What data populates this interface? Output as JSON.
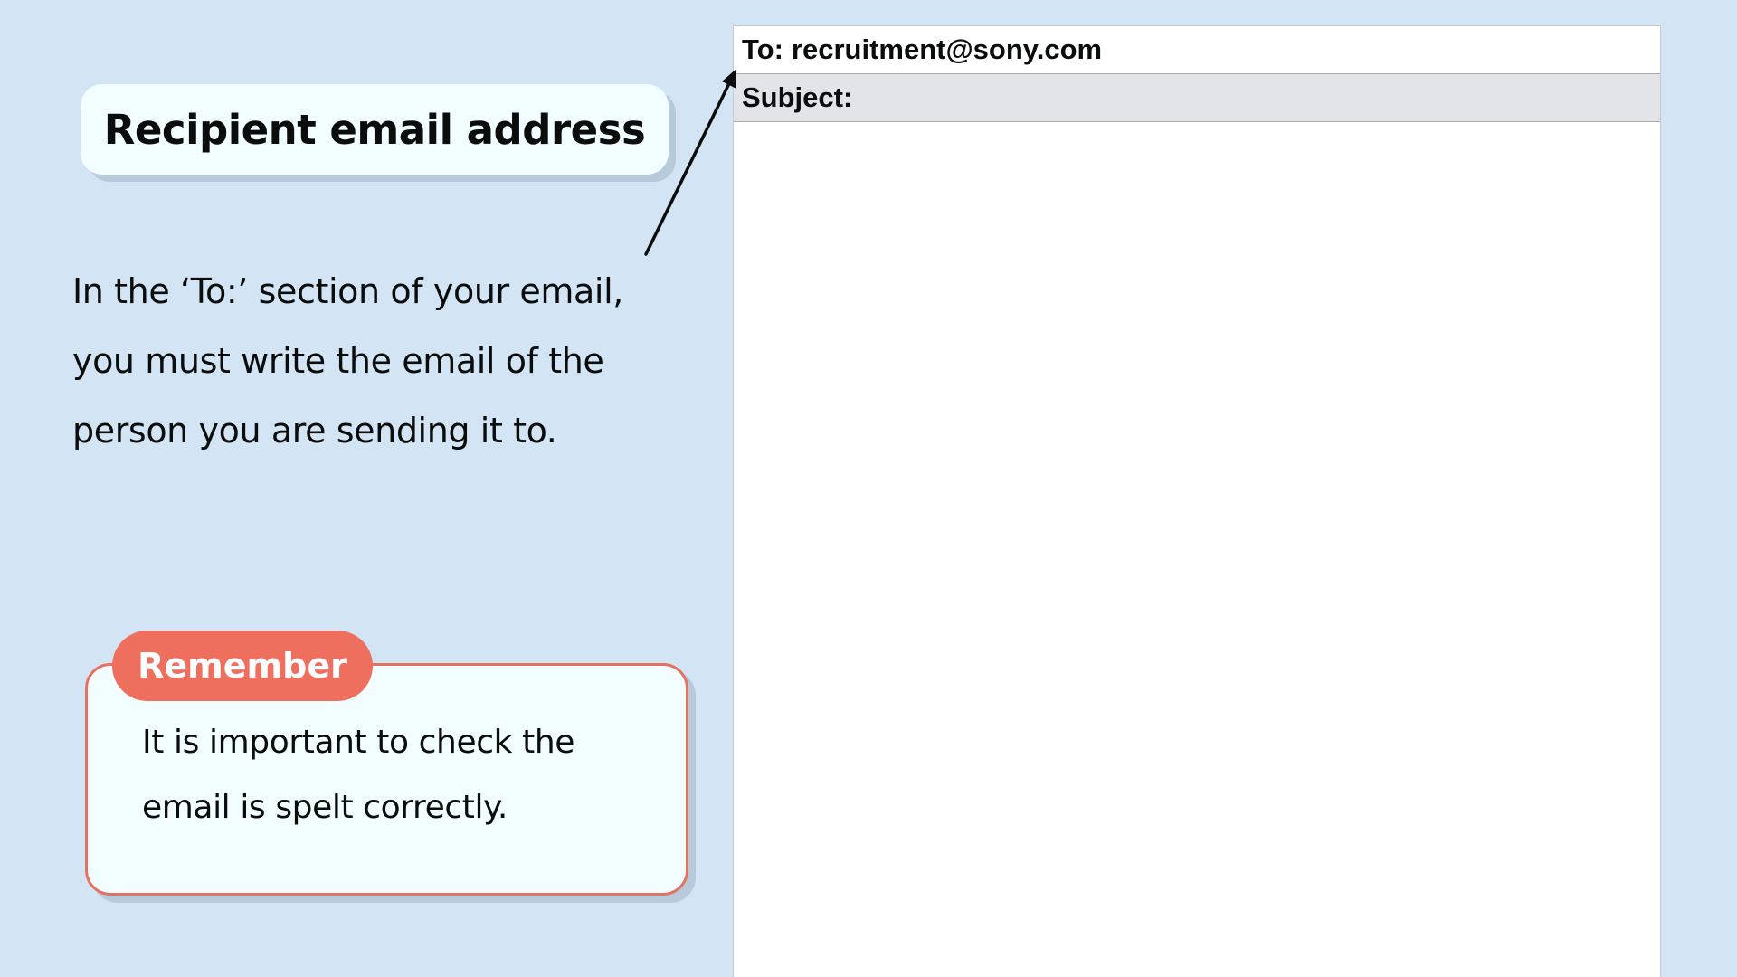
{
  "title": "Recipient email address",
  "explanation": {
    "lines": [
      "In the ‘To:’ section of your email,",
      "you must write the email of the",
      "person you are sending it to."
    ]
  },
  "remember": {
    "label": "Remember",
    "lines": [
      "It is important to check the",
      "email is spelt correctly."
    ]
  },
  "email": {
    "to_label": "To:",
    "to_value": "recruitment@sony.com",
    "subject_label": "Subject:",
    "subject_value": "",
    "body": ""
  },
  "colors": {
    "background": "#d3e5f4",
    "card": "#f1fdfe",
    "accent": "#ee6f5e",
    "accent_border": "#e57161",
    "subject_bg": "#e3e4e8"
  },
  "icons": {
    "pointer": "arrow-icon"
  }
}
